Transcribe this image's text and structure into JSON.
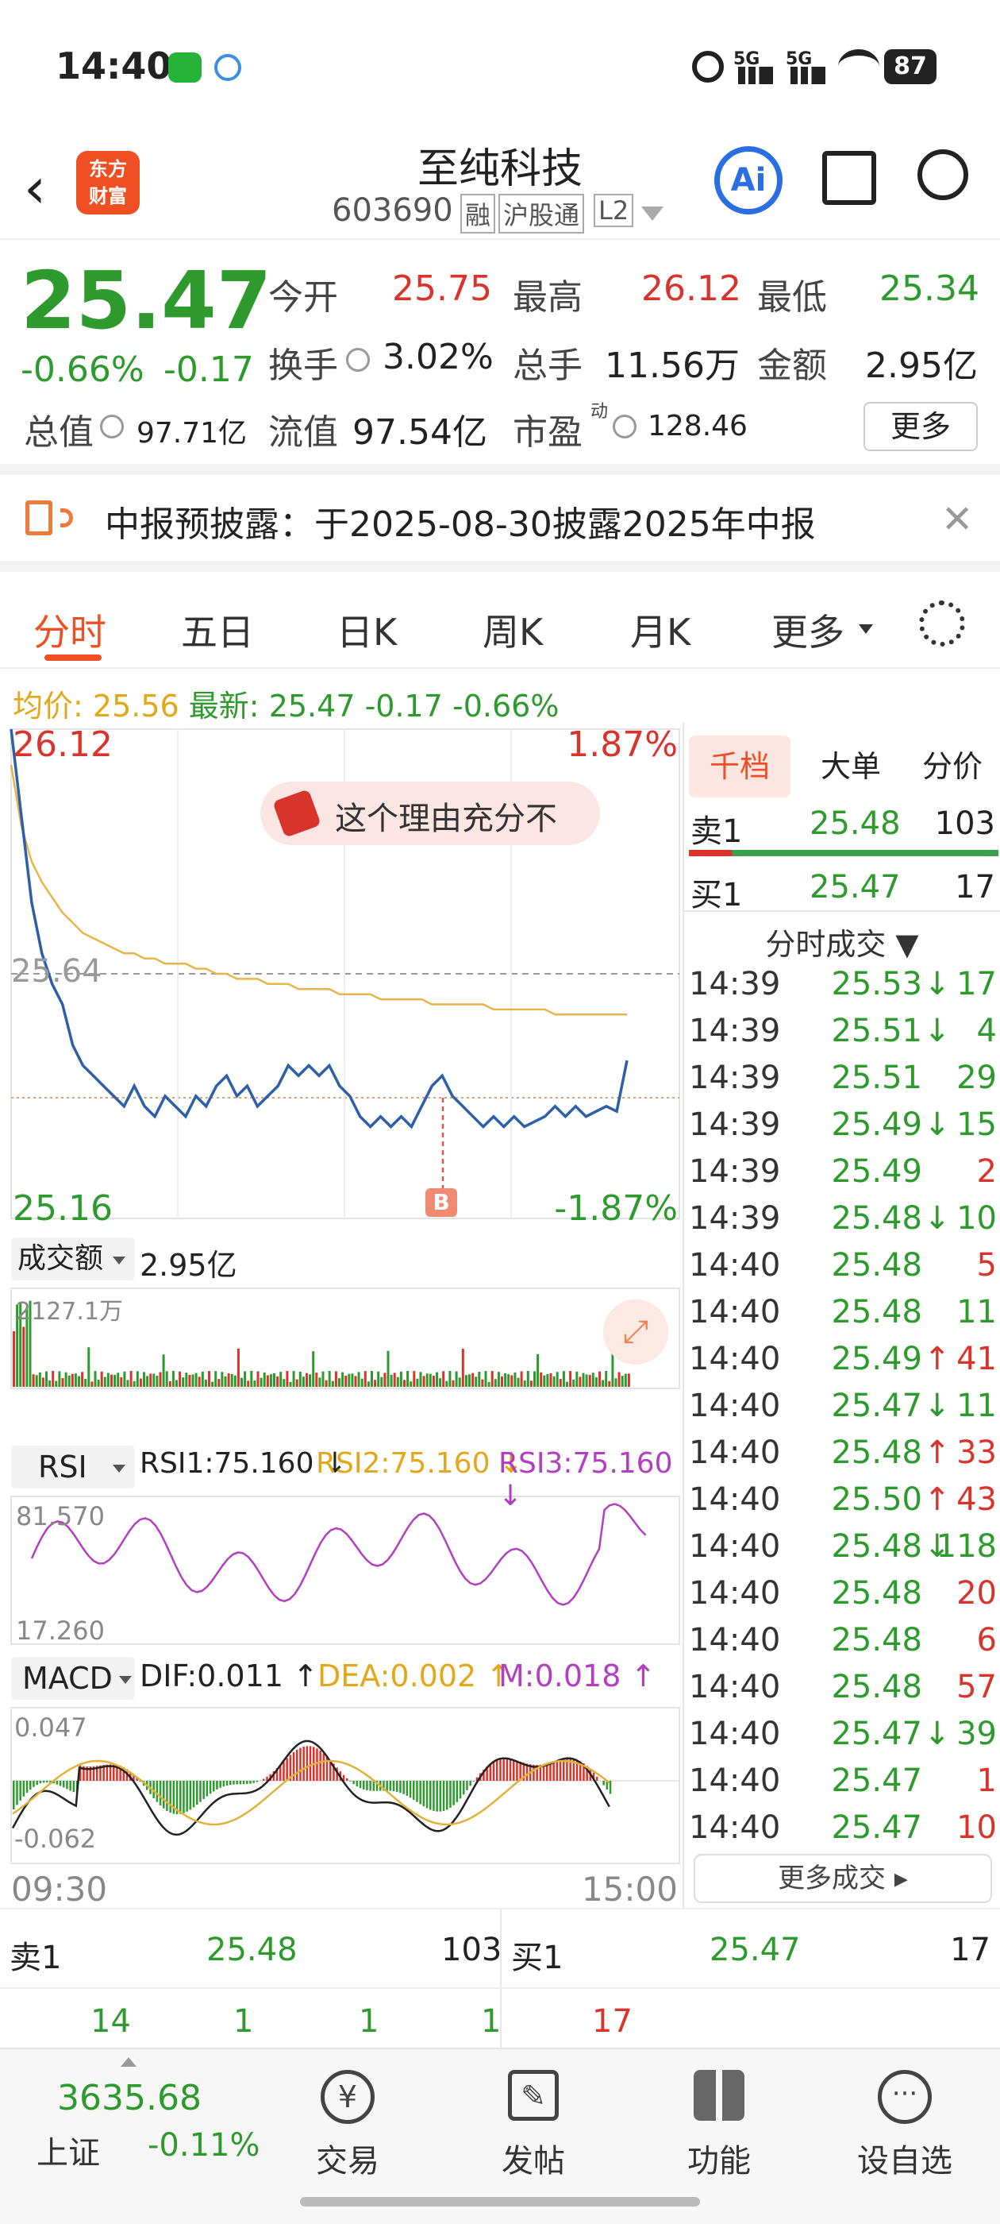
{
  "status": {
    "time": "14:40",
    "battery": "87",
    "net1": "5G",
    "net2": "5G"
  },
  "header": {
    "name": "至纯科技",
    "code": "603690",
    "tags": [
      "融",
      "沪股通",
      "L2"
    ],
    "logo": "东方\n财富",
    "ai": "Ai"
  },
  "quote": {
    "price": "25.47",
    "pct": "-0.66%",
    "chg": "-0.17",
    "open_l": "今开",
    "open": "25.75",
    "high_l": "最高",
    "high": "26.12",
    "low_l": "最低",
    "low": "25.34",
    "turn_l": "换手",
    "turn": "3.02%",
    "vol_l": "总手",
    "vol": "11.56万",
    "amt_l": "金额",
    "amt": "2.95亿",
    "mcap_l": "总值",
    "mcap": "97.71亿",
    "fcap_l": "流值",
    "fcap": "97.54亿",
    "pe_l": "市盈",
    "pe_sup": "动",
    "pe": "128.46",
    "more": "更多"
  },
  "notice": {
    "text": "中报预披露：于2025-08-30披露2025年中报"
  },
  "tabs": [
    "分时",
    "五日",
    "日K",
    "周K",
    "月K",
    "更多"
  ],
  "avgline": {
    "avg_l": "均价:",
    "avg": "25.56",
    "new_l": "最新:",
    "new": "25.47",
    "chg": "-0.17",
    "pct": "-0.66%"
  },
  "intraday": {
    "max": "26.12",
    "min": "25.16",
    "maxpct": "1.87%",
    "minpct": "-1.87%",
    "ref": "25.64",
    "bubble": "这个理由充分不",
    "marker": "B",
    "price": [
      26.12,
      25.95,
      25.78,
      25.68,
      25.62,
      25.58,
      25.5,
      25.46,
      25.44,
      25.42,
      25.4,
      25.38,
      25.42,
      25.38,
      25.36,
      25.4,
      25.38,
      25.36,
      25.4,
      25.38,
      25.42,
      25.44,
      25.4,
      25.42,
      25.38,
      25.4,
      25.42,
      25.46,
      25.44,
      25.46,
      25.44,
      25.46,
      25.42,
      25.4,
      25.36,
      25.34,
      25.36,
      25.34,
      25.36,
      25.34,
      25.38,
      25.42,
      25.44,
      25.4,
      25.38,
      25.36,
      25.34,
      25.36,
      25.34,
      25.36,
      25.34,
      25.35,
      25.36,
      25.38,
      25.36,
      25.38,
      25.36,
      25.37,
      25.38,
      25.37,
      25.47
    ],
    "avg": [
      26.05,
      25.93,
      25.86,
      25.82,
      25.79,
      25.76,
      25.74,
      25.72,
      25.71,
      25.7,
      25.69,
      25.68,
      25.68,
      25.67,
      25.67,
      25.66,
      25.66,
      25.66,
      25.65,
      25.65,
      25.64,
      25.64,
      25.63,
      25.63,
      25.63,
      25.62,
      25.62,
      25.62,
      25.61,
      25.61,
      25.61,
      25.61,
      25.6,
      25.6,
      25.6,
      25.6,
      25.59,
      25.59,
      25.59,
      25.59,
      25.59,
      25.58,
      25.58,
      25.58,
      25.58,
      25.58,
      25.58,
      25.57,
      25.57,
      25.57,
      25.57,
      25.57,
      25.57,
      25.56,
      25.56,
      25.56,
      25.56,
      25.56,
      25.56,
      25.56,
      25.56
    ]
  },
  "volume": {
    "label": "成交额",
    "total": "2.95亿",
    "max": "2127.1万"
  },
  "rsi": {
    "label": "RSI",
    "r1": "RSI1:75.160 ↓",
    "r2": "RSI2:75.160 ↓",
    "r3": "RSI3:75.160 ↓",
    "max": "81.570",
    "min": "17.260"
  },
  "macd": {
    "label": "MACD",
    "dif": "DIF:0.011 ↑",
    "dea": "DEA:0.002 ↑",
    "m": "M:0.018 ↑",
    "max": "0.047",
    "min": "-0.062"
  },
  "timeaxis": {
    "start": "09:30",
    "end": "15:00"
  },
  "side": {
    "tabs": [
      "千档",
      "大单",
      "分价"
    ],
    "sell_l": "卖1",
    "sell_p": "25.48",
    "sell_v": "103",
    "buy_l": "买1",
    "buy_p": "25.47",
    "buy_v": "17",
    "trades_title": "分时成交 ▼",
    "more": "更多成交 ▸",
    "trades": [
      [
        "14:39",
        "25.53",
        "↓",
        "17",
        "g"
      ],
      [
        "14:39",
        "25.51",
        "↓",
        "4",
        "g"
      ],
      [
        "14:39",
        "25.51",
        "",
        "29",
        "g"
      ],
      [
        "14:39",
        "25.49",
        "↓",
        "15",
        "g"
      ],
      [
        "14:39",
        "25.49",
        "",
        "2",
        "r"
      ],
      [
        "14:39",
        "25.48",
        "↓",
        "10",
        "g"
      ],
      [
        "14:40",
        "25.48",
        "",
        "5",
        "r"
      ],
      [
        "14:40",
        "25.48",
        "",
        "11",
        "g"
      ],
      [
        "14:40",
        "25.49",
        "↑",
        "41",
        "r"
      ],
      [
        "14:40",
        "25.47",
        "↓",
        "11",
        "g"
      ],
      [
        "14:40",
        "25.48",
        "↑",
        "33",
        "r"
      ],
      [
        "14:40",
        "25.50",
        "↑",
        "43",
        "r"
      ],
      [
        "14:40",
        "25.48",
        "↓",
        "118",
        "g"
      ],
      [
        "14:40",
        "25.48",
        "",
        "20",
        "r"
      ],
      [
        "14:40",
        "25.48",
        "",
        "6",
        "r"
      ],
      [
        "14:40",
        "25.48",
        "",
        "57",
        "r"
      ],
      [
        "14:40",
        "25.47",
        "↓",
        "39",
        "g"
      ],
      [
        "14:40",
        "25.47",
        "",
        "1",
        "r"
      ],
      [
        "14:40",
        "25.47",
        "",
        "10",
        "r"
      ]
    ]
  },
  "bottom": {
    "sell_l": "卖1",
    "sell_p": "25.48",
    "sell_v": "103",
    "buy_l": "买1",
    "buy_p": "25.47",
    "buy_v": "17",
    "row2": [
      "14",
      "1",
      "1",
      "1"
    ],
    "row2b": "17"
  },
  "nav": {
    "index": "3635.68",
    "index_l": "上证",
    "index_pct": "-0.11%",
    "items": [
      "交易",
      "发帖",
      "功能",
      "设自选"
    ]
  }
}
